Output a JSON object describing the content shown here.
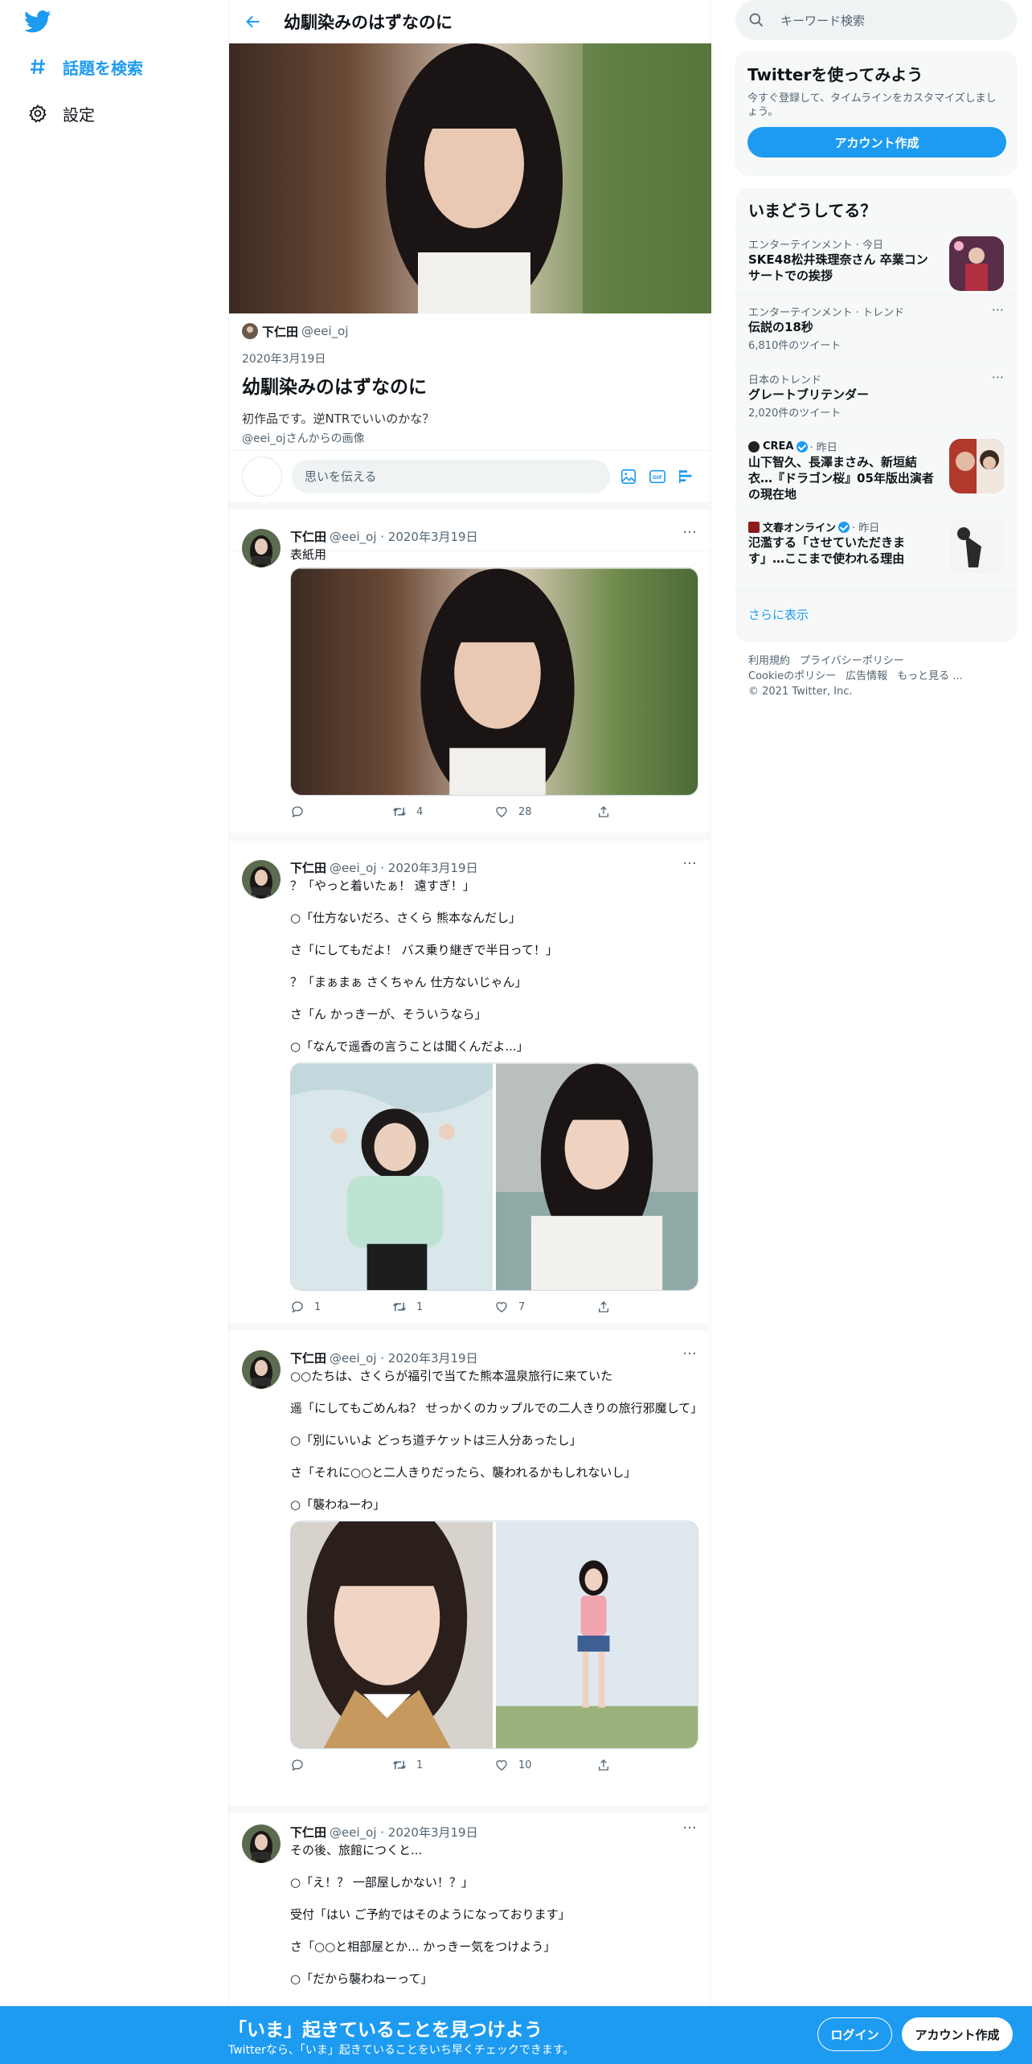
{
  "nav": {
    "explore_label": "話題を検索",
    "settings_label": "設定"
  },
  "header": {
    "title": "幼馴染みのはずなのに"
  },
  "moment": {
    "author_name": "下仁田",
    "author_handle": "@eei_oj",
    "date": "2020年3月19日",
    "title": "幼馴染みのはずなのに",
    "description": "初作品です。逆NTRでいいのかな？",
    "image_credit": "@eei_ojさんからの画像"
  },
  "compose": {
    "placeholder": "思いを伝える"
  },
  "tweets": [
    {
      "name": "下仁田",
      "meta": "@eei_oj · 2020年3月19日",
      "lines": [
        "表紙用"
      ],
      "reply": "",
      "retweet": "4",
      "like": "28"
    },
    {
      "name": "下仁田",
      "meta": "@eei_oj · 2020年3月19日",
      "lines": [
        "？「やっと着いたぁ！ 遠すぎ！」",
        "○「仕方ないだろ、さくら 熊本なんだし」",
        "さ「にしてもだよ！ バス乗り継ぎで半日って！」",
        "？「まぁまぁ さくちゃん 仕方ないじゃん」",
        "さ「ん かっきーが、そういうなら」",
        "○「なんで遥香の言うことは聞くんだよ...」"
      ],
      "reply": "1",
      "retweet": "1",
      "like": "7"
    },
    {
      "name": "下仁田",
      "meta": "@eei_oj · 2020年3月19日",
      "lines": [
        "○○たちは、さくらが福引で当てた熊本温泉旅行に来ていた",
        "遥「にしてもごめんね？ せっかくのカップルでの二人きりの旅行邪魔して」",
        "○「別にいいよ どっち道チケットは三人分あったし」",
        "さ「それに○○と二人きりだったら、襲われるかもしれないし」",
        "○「襲わねーわ」"
      ],
      "reply": "",
      "retweet": "1",
      "like": "10"
    },
    {
      "name": "下仁田",
      "meta": "@eei_oj · 2020年3月19日",
      "lines": [
        "その後、旅館につくと...",
        "○「え！？ 一部屋しかない！？」",
        "受付「はい ご予約ではそのようになっております」",
        "さ「○○と相部屋とか... かっきー気をつけよう」",
        "○「だから襲わねーって」"
      ]
    }
  ],
  "sidebar": {
    "search_placeholder": "キーワード検索",
    "signup_title": "Twitterを使ってみよう",
    "signup_desc": "今すぐ登録して、タイムラインをカスタマイズしましょう。",
    "signup_button": "アカウント作成",
    "trends_title": "いまどうしてる？",
    "trends": [
      {
        "category": "エンターテインメント · 今日",
        "name": "SKE48松井珠理奈さん 卒業コンサートでの挨拶",
        "count": ""
      },
      {
        "category": "エンターテインメント · トレンド",
        "name": "伝説の18秒",
        "count": "6,810件のツイート"
      },
      {
        "category": "日本のトレンド",
        "name": "グレートブリテンダー",
        "count": "2,020件のツイート"
      },
      {
        "source": "CREA",
        "category": "· 昨日",
        "name": "山下智久、長澤まさみ、新垣結衣…『ドラゴン桜』05年版出演者の現在地",
        "count": ""
      },
      {
        "source": "文春オンライン",
        "category": "· 昨日",
        "name": "氾濫する「させていただきます」…ここまで使われる理由",
        "count": ""
      }
    ],
    "show_more": "さらに表示",
    "footer": [
      "利用規約",
      "プライバシーポリシー",
      "Cookieのポリシー",
      "広告情報",
      "もっと見る ...",
      "© 2021 Twitter, Inc."
    ]
  },
  "bottom_bar": {
    "title": "「いま」起きていることを見つけよう",
    "subtitle": "Twitterなら、「いま」起きていることをいち早くチェックできます。",
    "login": "ログイン",
    "signup": "アカウント作成"
  }
}
